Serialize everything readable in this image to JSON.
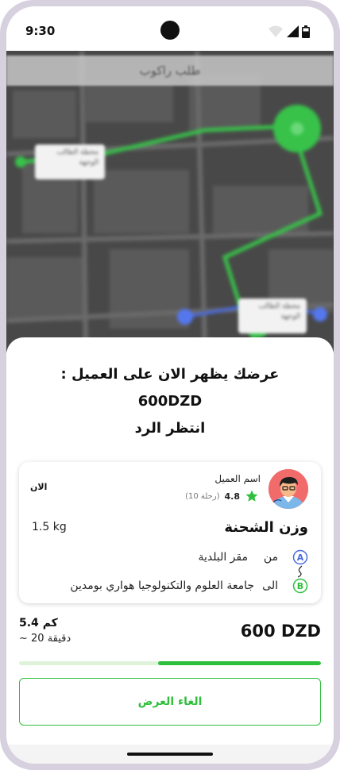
{
  "status_bar": {
    "time": "9:30"
  },
  "map": {
    "title": "طلب راكوب",
    "label_1": "محطة الطالب",
    "label_2": "الوجهة",
    "label_3": "محطة الطالب",
    "label_4": "الوجهة"
  },
  "offer": {
    "line1": "عرضك يظهر الان على العميل :",
    "amount": "600DZD",
    "line3": "انتظر الرد"
  },
  "client": {
    "time_label": "الان",
    "name": "اسم العميل",
    "rating": "4.8",
    "trips": "(10 رحلة)"
  },
  "shipment": {
    "weight_label": "وزن الشحنة",
    "weight_value": "1.5 kg",
    "from_label": "من",
    "from_value": "مقر البلدية",
    "to_label": "الى",
    "to_value": "جامعة العلوم والتكنولوجيا هواري بومدين"
  },
  "trip": {
    "distance": "5.4 كم",
    "duration": "~ 20 دقيقة",
    "price": "600 DZD",
    "progress": 0.54
  },
  "actions": {
    "cancel_label": "الغاء العرض"
  },
  "colors": {
    "accent": "#2fbf3c",
    "accent_light": "#dff3da",
    "avatar_bg": "#f26b6b"
  },
  "icons": [
    "wifi-icon",
    "signal-icon",
    "battery-icon",
    "star-icon",
    "location-a-icon",
    "location-b-icon",
    "route-link-icon",
    "avatar-icon"
  ]
}
